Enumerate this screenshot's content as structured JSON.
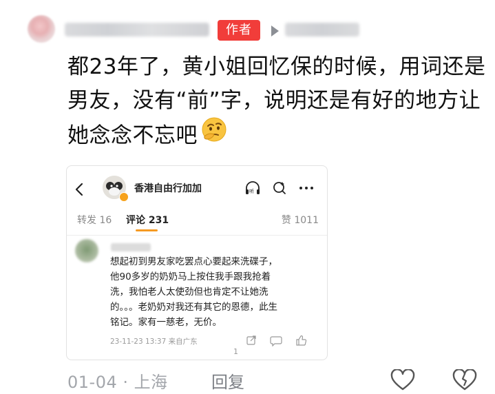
{
  "comment": {
    "author_badge": "作者",
    "text": "都23年了，黄小姐回忆保的时候，用词还是男友，没有“前”字，说明还是有好的地方让她念念不忘吧",
    "emoji": "thinking-face",
    "meta": "01-04 · 上海",
    "reply_label": "回复"
  },
  "embedded_post": {
    "account_name": "香港自由行加加",
    "tabs": {
      "repost": "转发 16",
      "comments": "评论 231",
      "likes": "赞 1011"
    },
    "comment": {
      "text": "想起初到男友家吃罢点心要起来洗碟子，他90多岁的奶奶马上按住我手跟我抢着洗，我怕老人太使劲但也肯定不让她洗的。。。老奶奶对我还有其它的恩德，此生铭记。家有一慈老，无价。",
      "time_location": "23-11-23 13:37 来自广东",
      "like_count": "1"
    }
  },
  "colors": {
    "badge_red": "#f13d3a",
    "accent_orange": "#f59a22",
    "meta_gray": "#a3a6ab"
  }
}
